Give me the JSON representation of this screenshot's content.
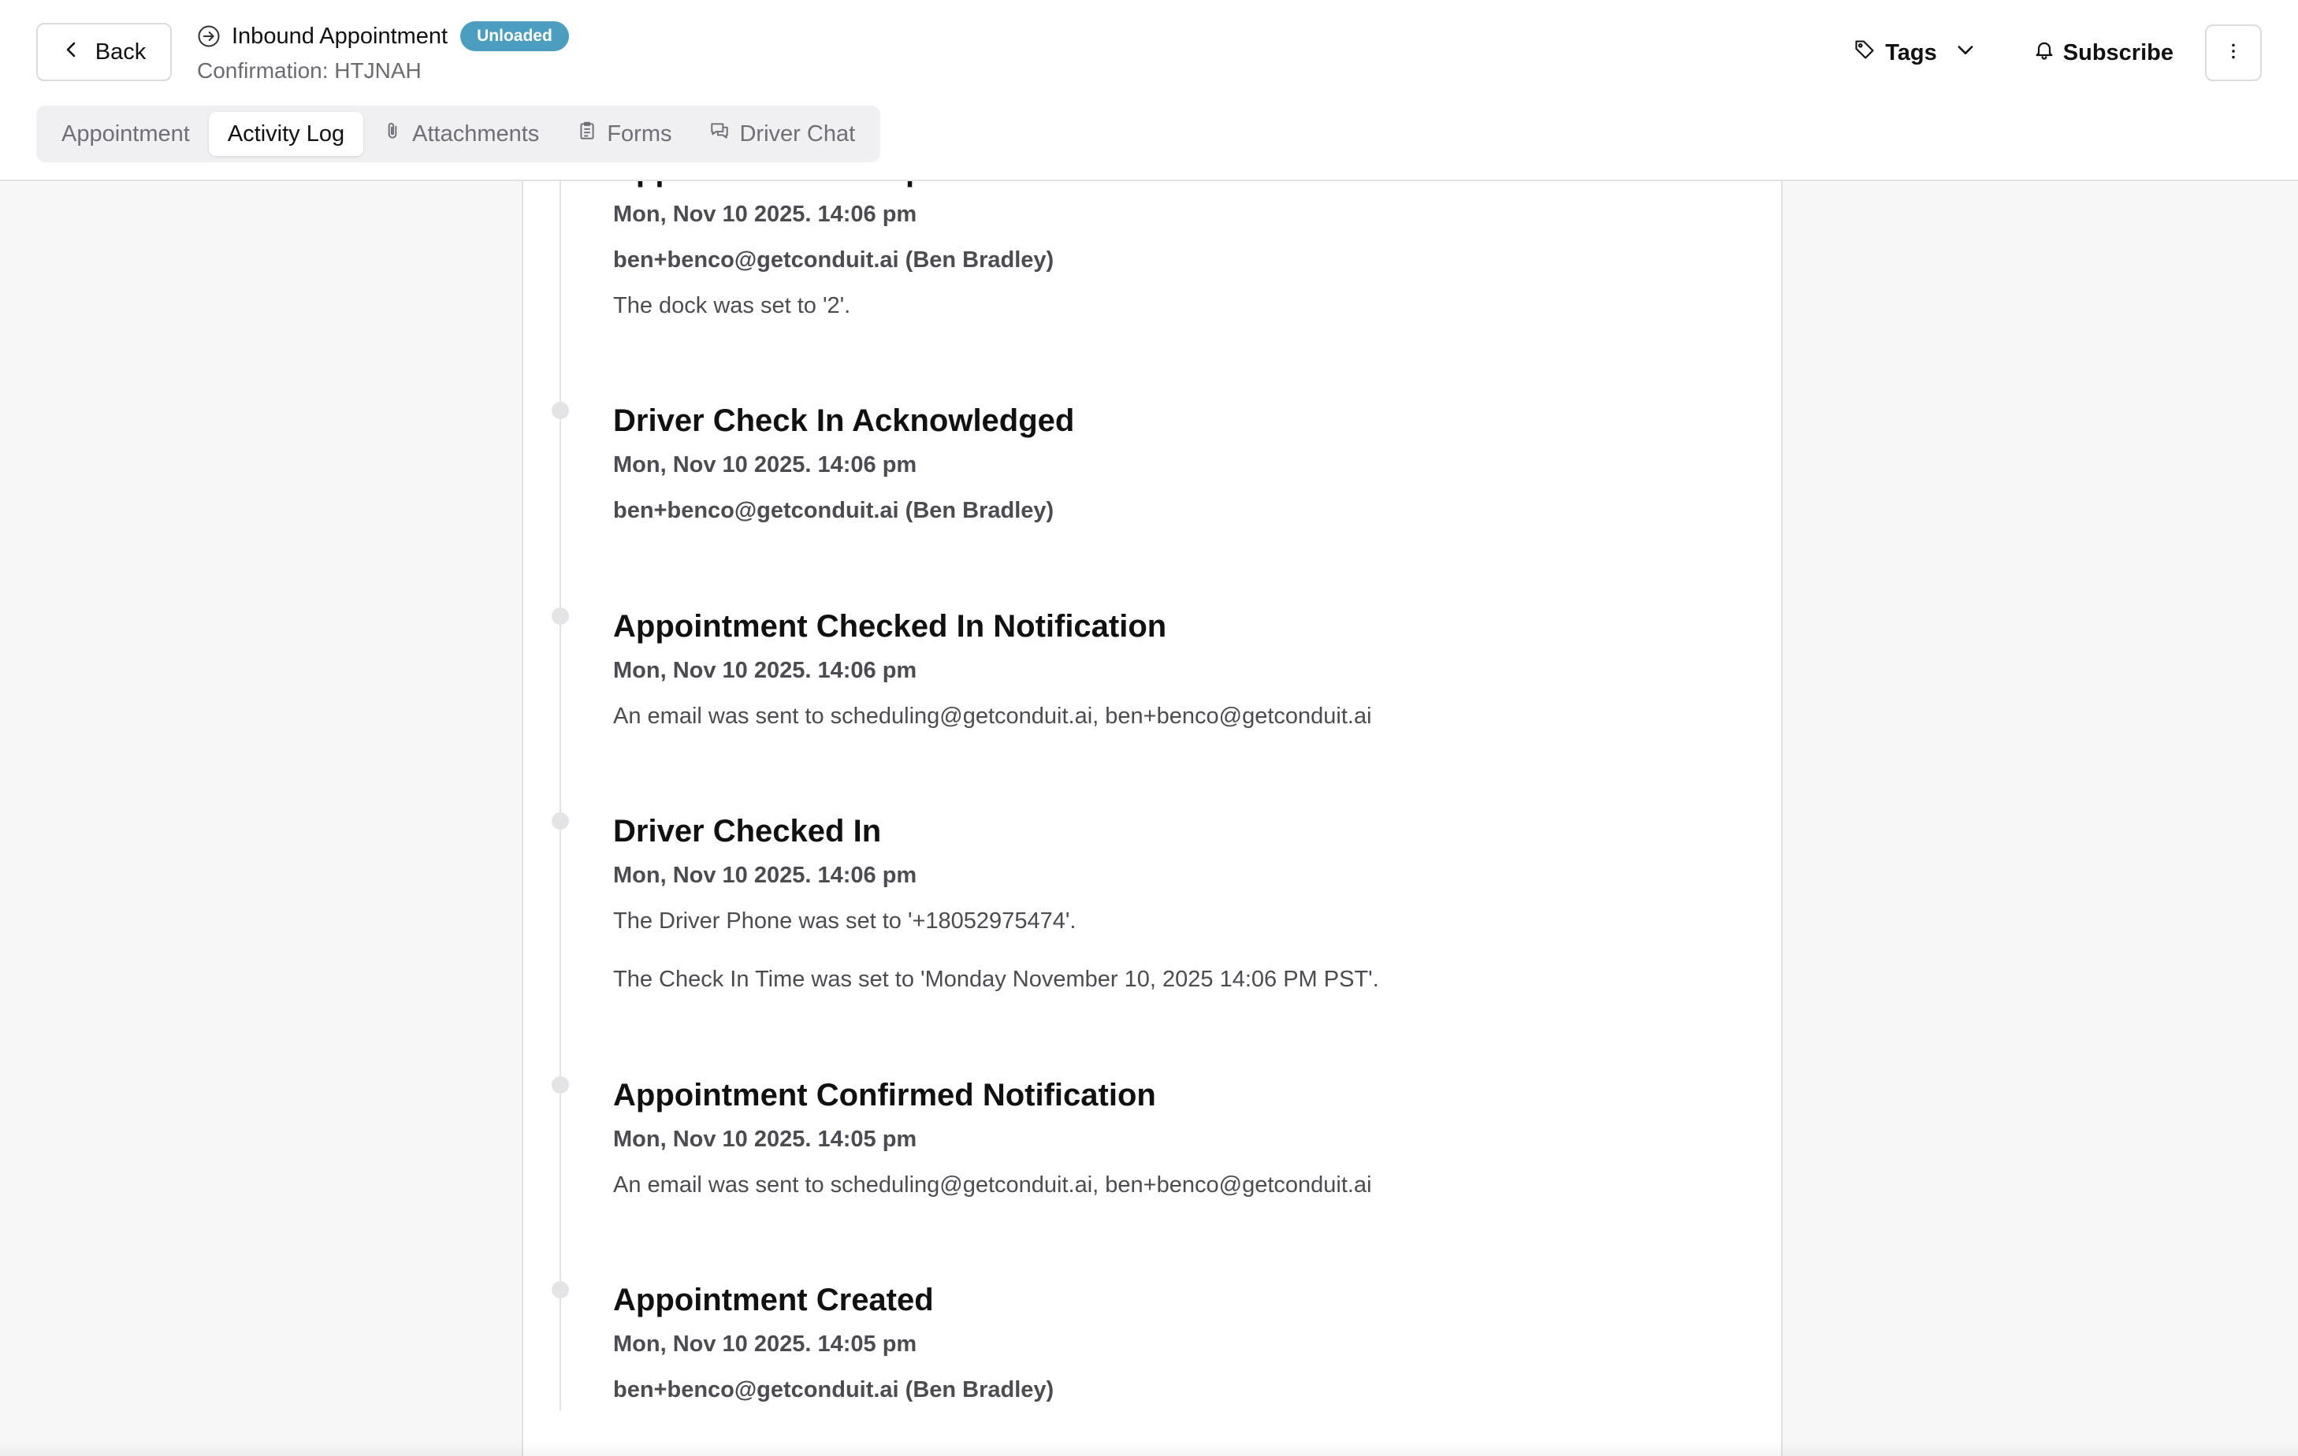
{
  "header": {
    "back_label": "Back",
    "title": "Inbound Appointment",
    "status_badge": "Unloaded",
    "confirmation": "Confirmation: HTJNAH",
    "tags_label": "Tags",
    "subscribe_label": "Subscribe",
    "badge_color": "#4b9ec0"
  },
  "tabs": [
    {
      "label": "Appointment",
      "icon": null,
      "active": false
    },
    {
      "label": "Activity Log",
      "icon": null,
      "active": true
    },
    {
      "label": "Attachments",
      "icon": "paperclip-icon",
      "active": false
    },
    {
      "label": "Forms",
      "icon": "clipboard-icon",
      "active": false
    },
    {
      "label": "Driver Chat",
      "icon": "chat-icon",
      "active": false
    }
  ],
  "events": [
    {
      "title": "Appointment Info Updated",
      "time": "Mon, Nov 10 2025. 14:06 pm",
      "user": "ben+benco@getconduit.ai (Ben Bradley)",
      "details": [
        "The dock was set to '2'."
      ]
    },
    {
      "title": "Driver Check In Acknowledged",
      "time": "Mon, Nov 10 2025. 14:06 pm",
      "user": "ben+benco@getconduit.ai (Ben Bradley)",
      "details": []
    },
    {
      "title": "Appointment Checked In Notification",
      "time": "Mon, Nov 10 2025. 14:06 pm",
      "user": null,
      "details": [
        "An email was sent to scheduling@getconduit.ai, ben+benco@getconduit.ai"
      ]
    },
    {
      "title": "Driver Checked In",
      "time": "Mon, Nov 10 2025. 14:06 pm",
      "user": null,
      "details": [
        "The Driver Phone was set to '+18052975474'.",
        "The Check In Time was set to 'Monday November 10, 2025 14:06 PM PST'."
      ]
    },
    {
      "title": "Appointment Confirmed Notification",
      "time": "Mon, Nov 10 2025. 14:05 pm",
      "user": null,
      "details": [
        "An email was sent to scheduling@getconduit.ai, ben+benco@getconduit.ai"
      ]
    },
    {
      "title": "Appointment Created",
      "time": "Mon, Nov 10 2025. 14:05 pm",
      "user": "ben+benco@getconduit.ai (Ben Bradley)",
      "details": []
    }
  ]
}
